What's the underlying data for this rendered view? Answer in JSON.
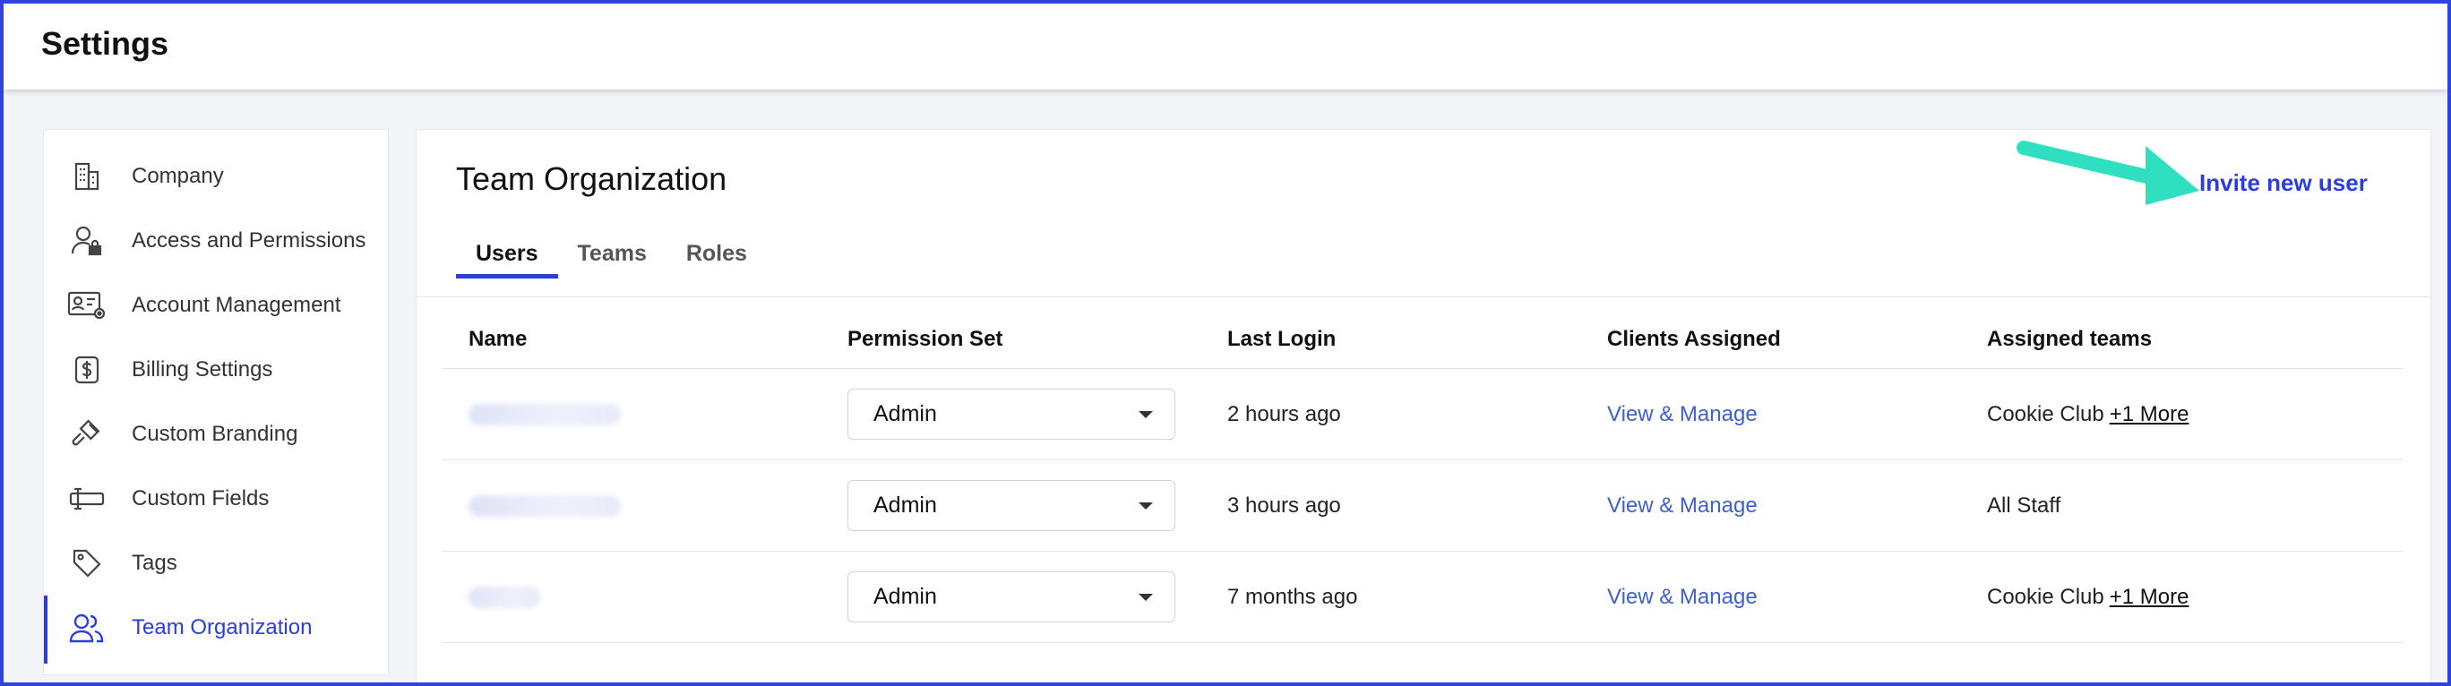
{
  "header": {
    "title": "Settings"
  },
  "sidebar": {
    "items": [
      {
        "label": "Company",
        "icon": "building-icon"
      },
      {
        "label": "Access and Permissions",
        "icon": "user-lock-icon"
      },
      {
        "label": "Account Management",
        "icon": "id-card-gear-icon"
      },
      {
        "label": "Billing Settings",
        "icon": "dollar-icon"
      },
      {
        "label": "Custom Branding",
        "icon": "brush-icon"
      },
      {
        "label": "Custom Fields",
        "icon": "text-field-icon"
      },
      {
        "label": "Tags",
        "icon": "tag-icon"
      },
      {
        "label": "Team Organization",
        "icon": "users-icon",
        "active": true
      }
    ]
  },
  "main": {
    "title": "Team Organization",
    "invite_label": "Invite new user",
    "tabs": [
      {
        "label": "Users",
        "active": true
      },
      {
        "label": "Teams"
      },
      {
        "label": "Roles"
      }
    ],
    "table": {
      "headers": [
        "Name",
        "Permission Set",
        "Last Login",
        "Clients Assigned",
        "Assigned teams"
      ],
      "rows": [
        {
          "permission": "Admin",
          "last_login": "2 hours ago",
          "clients": "View & Manage",
          "teams": "Cookie Club",
          "more": "+1 More"
        },
        {
          "permission": "Admin",
          "last_login": "3 hours ago",
          "clients": "View & Manage",
          "teams": "All Staff",
          "more": ""
        },
        {
          "permission": "Admin",
          "last_login": "7 months ago",
          "clients": "View & Manage",
          "teams": "Cookie Club",
          "more": "+1 More"
        }
      ]
    }
  },
  "colors": {
    "accent": "#2b3de0",
    "arrow": "#2fe0c0",
    "link": "#3d5fd0"
  }
}
